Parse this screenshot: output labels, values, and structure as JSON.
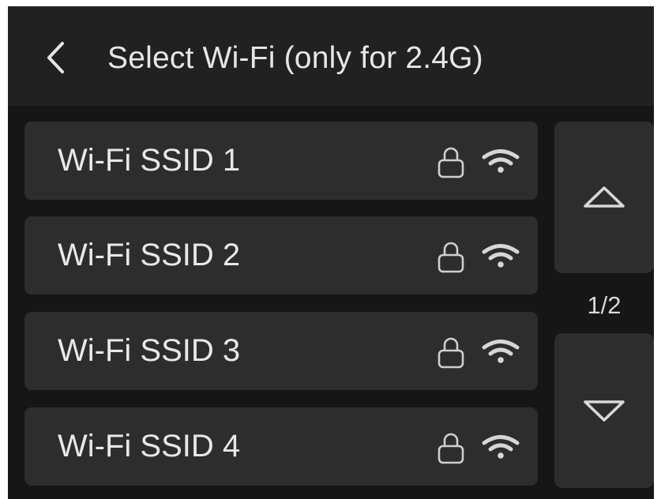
{
  "header": {
    "title": "Select Wi-Fi (only for 2.4G)",
    "back_icon": "chevron-left-icon"
  },
  "networks": [
    {
      "ssid": "Wi-Fi SSID 1",
      "locked": true,
      "signal": "strong"
    },
    {
      "ssid": "Wi-Fi SSID 2",
      "locked": true,
      "signal": "strong"
    },
    {
      "ssid": "Wi-Fi SSID 3",
      "locked": true,
      "signal": "strong"
    },
    {
      "ssid": "Wi-Fi SSID 4",
      "locked": true,
      "signal": "strong"
    }
  ],
  "pager": {
    "indicator": "1/2",
    "current_page": 1,
    "total_pages": 2,
    "up_icon": "triangle-up-icon",
    "down_icon": "triangle-down-icon"
  },
  "colors": {
    "background": "#161616",
    "header": "#212121",
    "row": "#2d2d2d",
    "text": "#e6e6e6",
    "icon": "#cfcfcf"
  }
}
